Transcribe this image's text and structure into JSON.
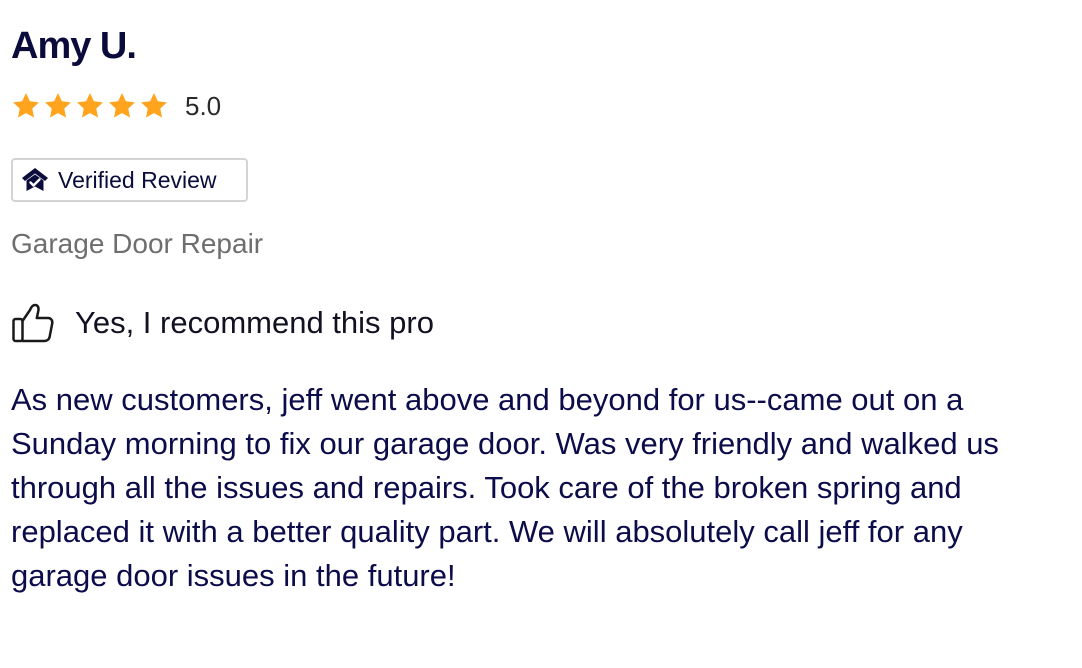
{
  "review": {
    "reviewer_name": "Amy U.",
    "rating": {
      "stars_filled": 5,
      "stars_total": 5,
      "value_label": "5.0",
      "star_color": "#FFA41C"
    },
    "verified_badge": {
      "label": "Verified Review",
      "icon": "house-check-icon"
    },
    "service_category": "Garage Door Repair",
    "recommendation": {
      "icon": "thumbs-up-icon",
      "label": "Yes, I recommend this pro"
    },
    "body": "As new customers, jeff went above and beyond for us--came out on a Sunday morning to fix our garage door. Was very friendly and walked us through all the issues and repairs. Took care of the broken spring and replaced it with a better quality part. We will absolutely call jeff for any garage door issues in the future!"
  },
  "colors": {
    "text_primary": "#0C0C3C",
    "text_secondary": "#6E6E6E",
    "badge_border": "#D4D4D4",
    "star": "#FFA41C"
  }
}
